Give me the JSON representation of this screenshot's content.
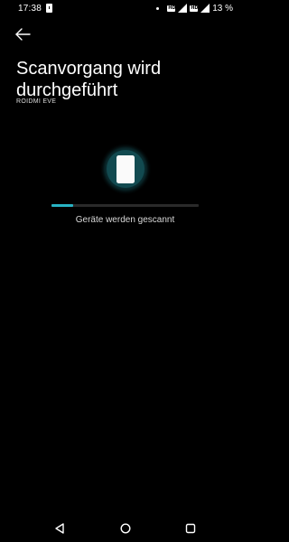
{
  "status_bar": {
    "time": "17:38",
    "battery": "13 %",
    "icons": [
      "lock-icon",
      "dot-icon",
      "hd-badge-icon",
      "signal-icon",
      "hd-badge-icon",
      "signal-icon"
    ]
  },
  "header": {
    "back_icon": "back-arrow-icon",
    "title": "Scanvorgang wird durchgeführt",
    "device_name": "ROIDMI EVE"
  },
  "scan": {
    "illustration_icon": "phone-icon",
    "progress_fraction": 0.15,
    "status_text": "Geräte werden gescannt"
  },
  "nav_bar": {
    "icons": [
      "back-triangle-icon",
      "home-circle-icon",
      "recents-square-icon"
    ]
  },
  "colors": {
    "background": "#000000",
    "accent": "#28b3c4",
    "progress_track": "#2a2a2a",
    "glow": "#1a5f66"
  }
}
